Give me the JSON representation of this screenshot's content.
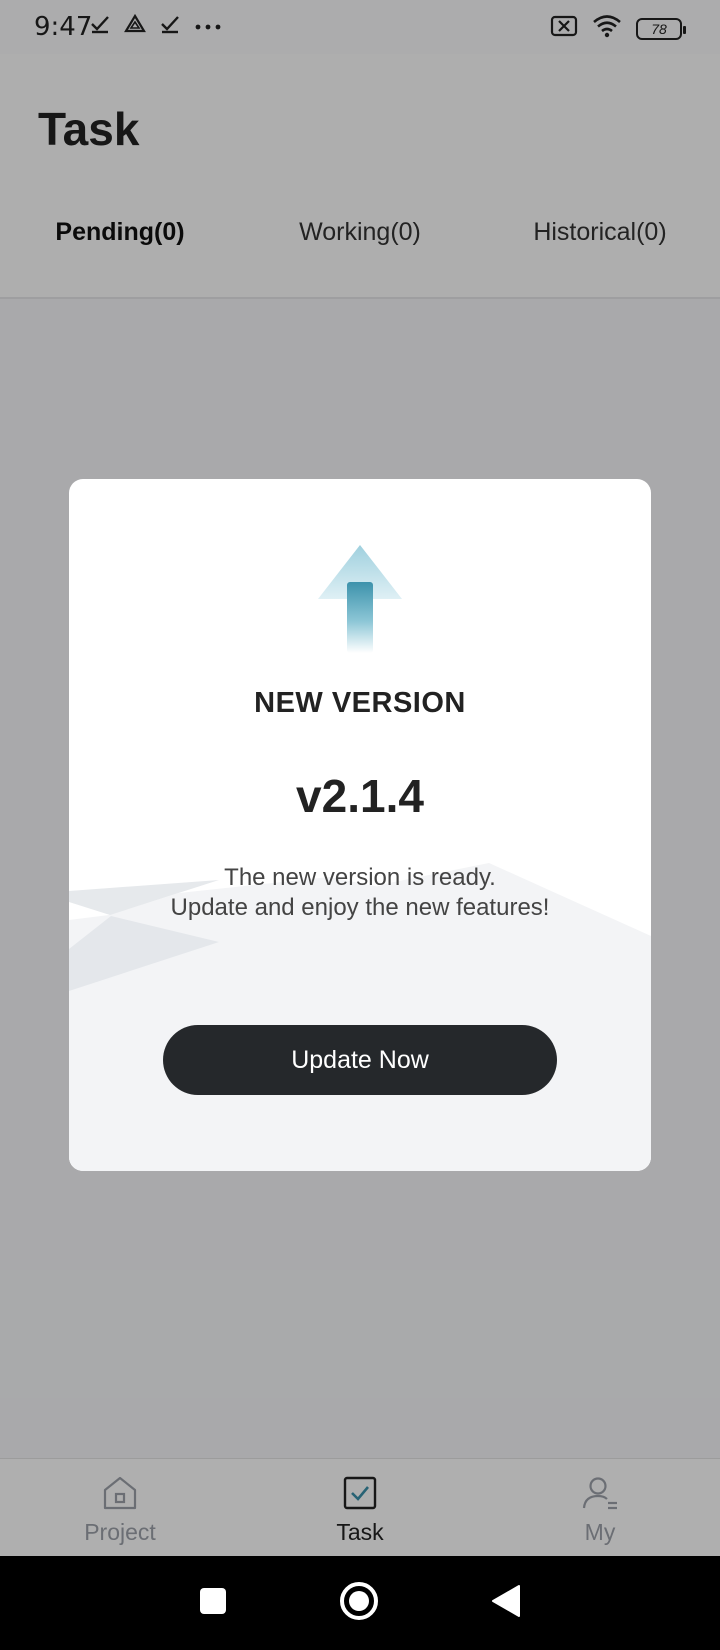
{
  "status_bar": {
    "time": "9:47",
    "battery": "78",
    "left_icons": [
      "check-icon",
      "drive-icon",
      "check-icon",
      "more-dots-icon"
    ],
    "right_icons": [
      "sim-off-icon",
      "wifi-icon",
      "battery-icon"
    ]
  },
  "header": {
    "title": "Task",
    "tabs": [
      {
        "label": "Pending(0)",
        "active": true
      },
      {
        "label": "Working(0)",
        "active": false
      },
      {
        "label": "Historical(0)",
        "active": false
      }
    ]
  },
  "dialog": {
    "icon": "upload-arrow-icon",
    "title": "NEW VERSION",
    "version": "v2.1.4",
    "message_line1": "The new version is ready.",
    "message_line2": "Update and enjoy the new features!",
    "button_label": "Update Now",
    "button_color": "#25282b"
  },
  "bottom_nav": {
    "items": [
      {
        "label": "Project",
        "icon": "home-icon",
        "active": false
      },
      {
        "label": "Task",
        "icon": "checkbox-icon",
        "active": true
      },
      {
        "label": "My",
        "icon": "user-icon",
        "active": false
      }
    ]
  },
  "system_nav": [
    "recents-square-icon",
    "home-circle-icon",
    "back-triangle-icon"
  ],
  "colors": {
    "accent": "#3a8fa8",
    "inactive": "#9a9ea6",
    "overlay": "rgba(0,0,0,0.30)"
  }
}
